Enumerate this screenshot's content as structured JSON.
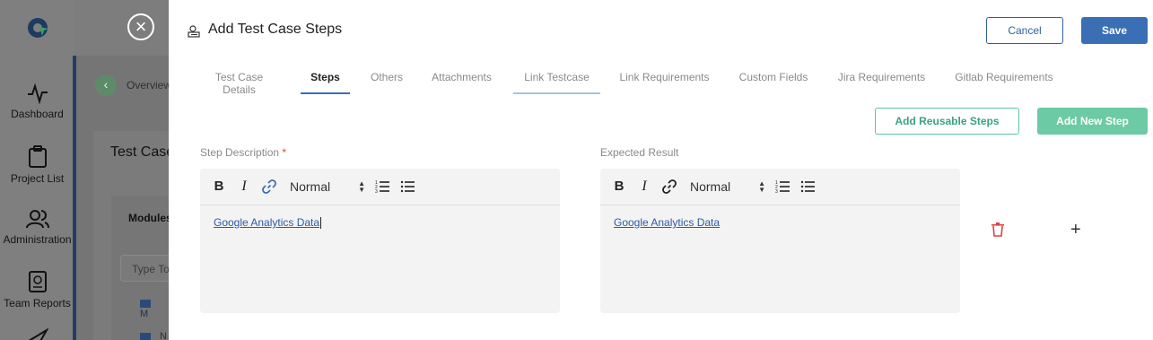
{
  "background": {
    "sidebar": [
      {
        "label": "Dashboard",
        "icon": "activity-icon"
      },
      {
        "label": "Project List",
        "icon": "clipboard-icon"
      },
      {
        "label": "Administration",
        "icon": "users-icon"
      },
      {
        "label": "Team Reports",
        "icon": "report-icon"
      }
    ],
    "breadcrumb": "Overview",
    "page_title": "Test Case",
    "modules_label": "Modules",
    "search_placeholder": "Type To",
    "folder1": "M",
    "folder2": "N"
  },
  "modal": {
    "title": "Add Test Case Steps",
    "cancel_label": "Cancel",
    "save_label": "Save",
    "tabs": [
      {
        "label": "Test Case Details"
      },
      {
        "label": "Steps"
      },
      {
        "label": "Others"
      },
      {
        "label": "Attachments"
      },
      {
        "label": "Link Testcase"
      },
      {
        "label": "Link Requirements"
      },
      {
        "label": "Custom Fields"
      },
      {
        "label": "Jira Requirements"
      },
      {
        "label": "Gitlab Requirements"
      }
    ],
    "active_tab": "Steps",
    "add_reusable_label": "Add Reusable Steps",
    "add_new_step_label": "Add New Step",
    "step_description_label": "Step Description",
    "required_mark": "*",
    "expected_result_label": "Expected Result",
    "format_select": "Normal",
    "step_description_value": "Google Analytics Data",
    "expected_result_value": "Google Analytics Data"
  },
  "colors": {
    "primary": "#3a6fb5",
    "success": "#6ccaa5",
    "danger": "#e04040"
  }
}
